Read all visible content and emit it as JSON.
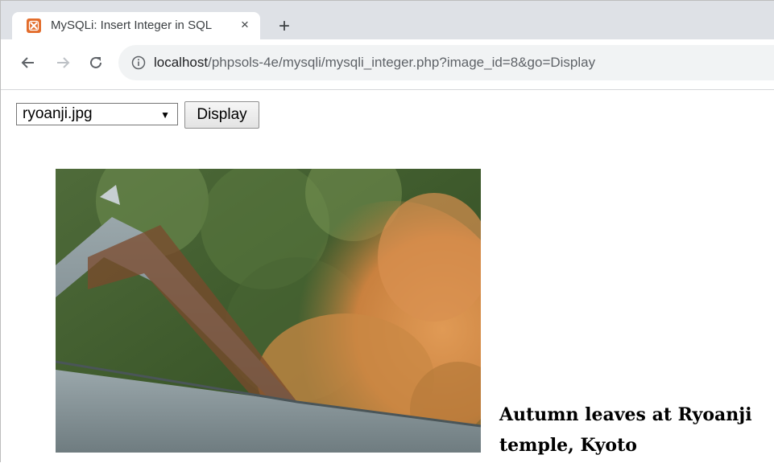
{
  "tab": {
    "title": "MySQLi: Insert Integer in SQL",
    "close": "×",
    "new_tab": "+"
  },
  "address": {
    "host": "localhost",
    "path": "/phpsols-4e/mysqli/mysqli_integer.php?image_id=8&go=Display"
  },
  "form": {
    "selected_image": "ryoanji.jpg",
    "display_button": "Display"
  },
  "image": {
    "caption": "Autumn leaves at Ryoanji temple, Kyoto"
  },
  "colors": {
    "favicon": "#e36d2c",
    "tabstrip": "#dee1e6",
    "omnibox": "#f1f3f4"
  }
}
